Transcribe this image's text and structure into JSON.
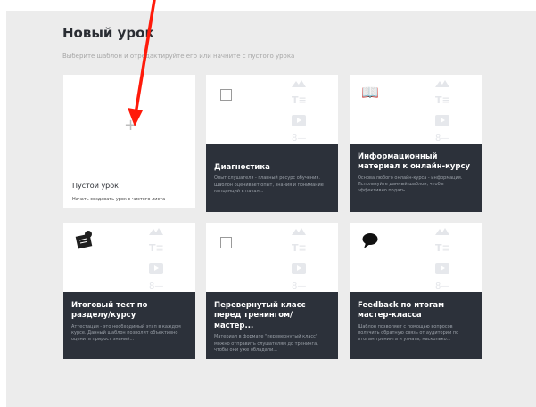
{
  "page": {
    "title": "Новый урок",
    "subtitle": "Выберите шаблон и отредактируйте его или начните с пустого урока"
  },
  "empty_card": {
    "icon": "plus-icon",
    "plus": "+",
    "title": "Пустой урок",
    "description": "Начать создавать урок с чистого листа"
  },
  "templates": [
    {
      "icon": "checkbox-icon",
      "icon_glyph": "",
      "title": "Диагностика",
      "description": "Опыт слушателя - главный ресурс обучения. Шаблон оценивает опыт, знания и понимание концепций в начал..."
    },
    {
      "icon": "book-icon",
      "icon_glyph": "📖",
      "title": "Информационный материал к онлайн-курсу",
      "description": "Основа любого онлайн-курса - информация. Используйте данный шаблон, чтобы эффективно подать..."
    },
    {
      "icon": "certificate-icon",
      "icon_glyph": "",
      "title": "Итоговый тест по разделу/курсу",
      "description": "Аттестация - это необходимый этап в каждом курсе. Данный шаблон позволит объективно оценить прирост знаний..."
    },
    {
      "icon": "checkbox-icon",
      "icon_glyph": "",
      "title": "Перевернутый класс перед тренингом/мастер...",
      "description": "Материал в формате \"перевернутый класс\" можно отправить слушателям до тренинга, чтобы они уже обладали..."
    },
    {
      "icon": "speech-bubble-icon",
      "icon_glyph": "",
      "title": "Feedback по итогам мастер-класса",
      "description": "Шаблон позволяет с помощью вопросов получить обратную связь от аудитории по итогам тренинга и узнать, насколько..."
    }
  ],
  "placeholder_glyphs": {
    "text": "T≡",
    "list": "8—"
  },
  "colors": {
    "accent_arrow": "#ff1a0a",
    "panel_bg": "#2c313a",
    "canvas_bg": "#ececec"
  }
}
